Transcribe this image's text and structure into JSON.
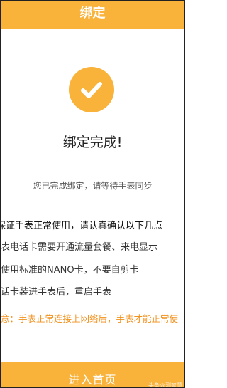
{
  "header": {
    "title": "绑定"
  },
  "status": {
    "icon": "checkmark-icon",
    "title": "绑定完成!",
    "subtitle": "您已完成绑定，请等待手表同步"
  },
  "tips": {
    "lead": "保证手表正常使用，请认真确认以下几点",
    "items": [
      "表电话卡需要开通流量套餐、来电显示",
      "使用标准的NANO卡，不要自剪卡",
      "话卡装进手表后，重启手表"
    ],
    "warning": "意：手表正常连接上网络后，手表才能正常使"
  },
  "footer": {
    "button_label": "进入首页",
    "watermark": "头条@测智慧"
  },
  "colors": {
    "accent": "#f9b33a",
    "warning": "#f2921d"
  }
}
